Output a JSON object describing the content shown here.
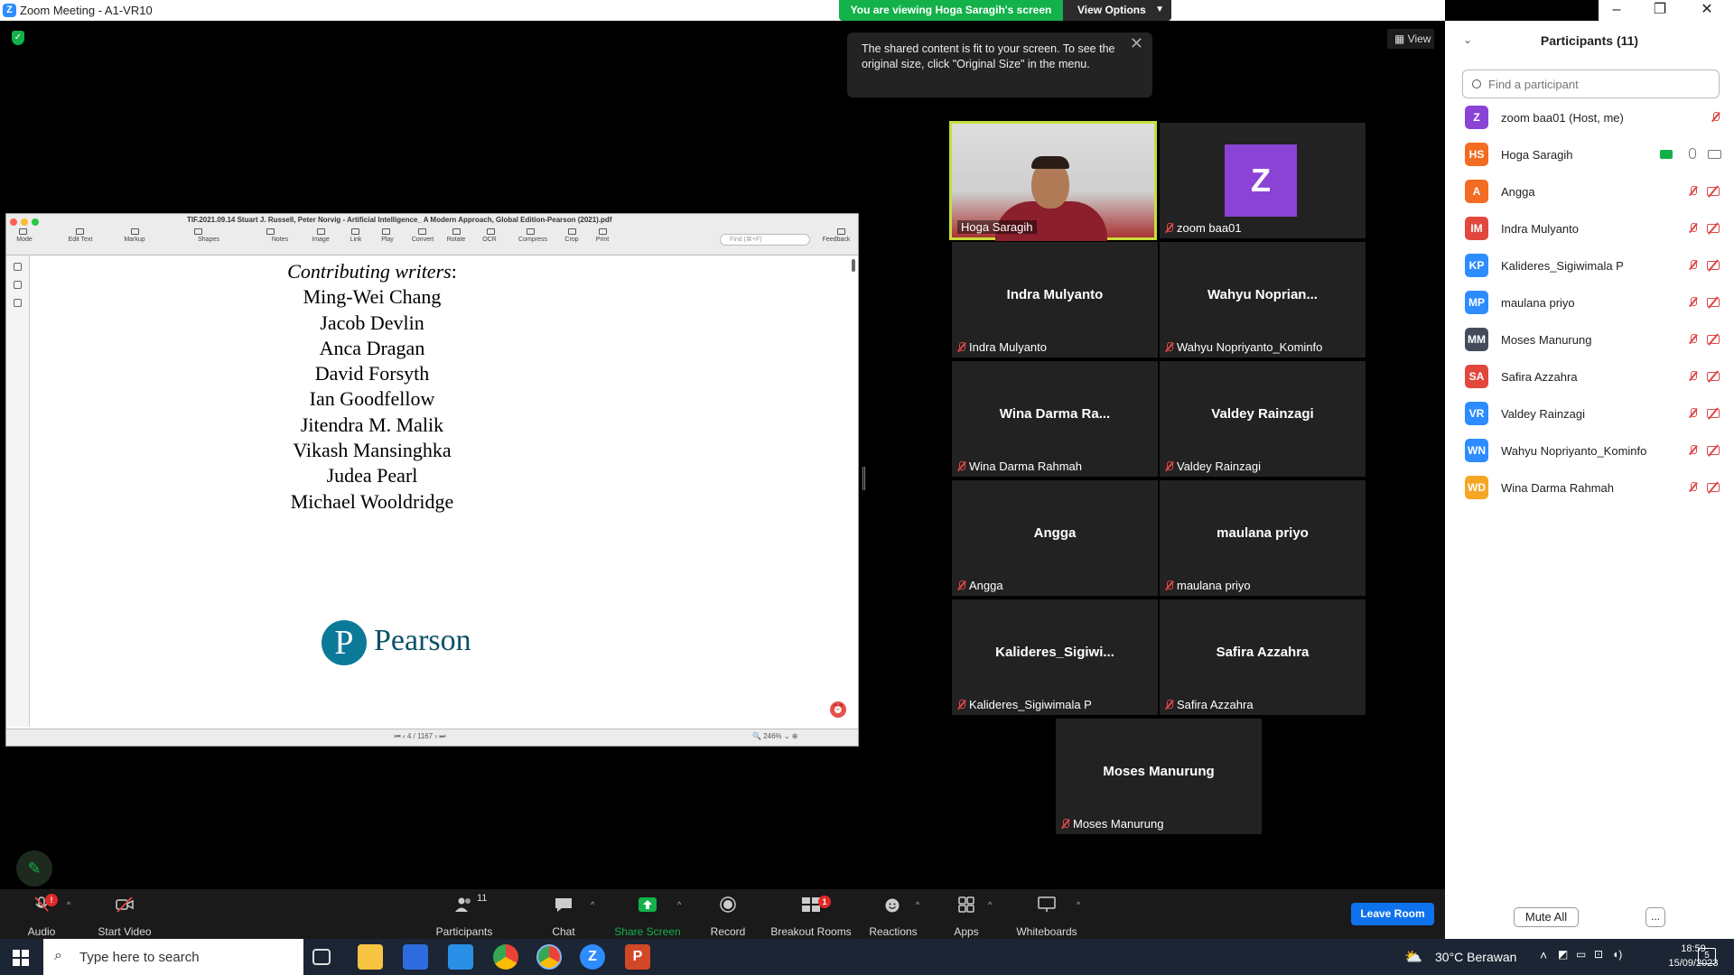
{
  "window": {
    "title": "Zoom Meeting - A1-VR10"
  },
  "banner": {
    "viewing": "You are viewing Hoga Saragih's screen",
    "view_options": "View Options",
    "view": "View"
  },
  "tooltip": {
    "text": "The shared content is fit to your screen. To see the original size, click \"Original Size\" in the menu."
  },
  "pdf": {
    "title": "TIF.2021.09.14 Stuart J. Russell, Peter Norvig - Artificial Intelligence_ A Modern Approach, Global Edition-Pearson (2021).pdf",
    "toolbar": [
      "Mode",
      "Edit Text",
      "Markup",
      "Shapes",
      "Notes",
      "Image",
      "Link",
      "Play",
      "Convert",
      "Rotate",
      "OCR",
      "Compress",
      "Crop",
      "Print",
      "Feedback"
    ],
    "find_placeholder": "Find (⌘+F)",
    "heading": "Contributing writers",
    "writers": [
      "Ming-Wei Chang",
      "Jacob Devlin",
      "Anca Dragan",
      "David Forsyth",
      "Ian Goodfellow",
      "Jitendra M. Malik",
      "Vikash Mansinghka",
      "Judea Pearl",
      "Michael Wooldridge"
    ],
    "publisher": "Pearson",
    "page_current": "4",
    "page_total": "/ 1167",
    "zoom": "246%"
  },
  "gallery": [
    {
      "display": "",
      "label": "Hoga Saragih",
      "video": true,
      "muted": false
    },
    {
      "display": "Z",
      "label": "zoom baa01",
      "video": false,
      "muted": true,
      "avatar": true
    },
    {
      "display": "Indra Mulyanto",
      "label": "Indra Mulyanto",
      "muted": true
    },
    {
      "display": "Wahyu  Noprian...",
      "label": "Wahyu Nopriyanto_Kominfo",
      "muted": true
    },
    {
      "display": "Wina  Darma Ra...",
      "label": "Wina Darma Rahmah",
      "muted": true
    },
    {
      "display": "Valdey Rainzagi",
      "label": "Valdey Rainzagi",
      "muted": true
    },
    {
      "display": "Angga",
      "label": "Angga",
      "muted": true
    },
    {
      "display": "maulana priyo",
      "label": "maulana priyo",
      "muted": true
    },
    {
      "display": "Kalideres_Sigiwi...",
      "label": "Kalideres_Sigiwimala P",
      "muted": true
    },
    {
      "display": "Safira Azzahra",
      "label": "Safira Azzahra",
      "muted": true
    },
    {
      "display": "Moses Manurung",
      "label": "Moses Manurung",
      "muted": true
    }
  ],
  "participants_panel": {
    "title": "Participants (11)",
    "search_placeholder": "Find a participant",
    "mute_all": "Mute All",
    "more": "...",
    "list": [
      {
        "initials": "Z",
        "name": "zoom baa01 (Host, me)",
        "color": "#8b43d6"
      },
      {
        "initials": "HS",
        "name": "Hoga Saragih",
        "color": "#f36c21"
      },
      {
        "initials": "A",
        "name": "Angga",
        "color": "#f36c21"
      },
      {
        "initials": "IM",
        "name": "Indra Mulyanto",
        "color": "#e2473d"
      },
      {
        "initials": "KP",
        "name": "Kalideres_Sigiwimala P",
        "color": "#2d8cff"
      },
      {
        "initials": "MP",
        "name": "maulana priyo",
        "color": "#2d8cff"
      },
      {
        "initials": "MM",
        "name": "Moses Manurung",
        "color": "#444c5c"
      },
      {
        "initials": "SA",
        "name": "Safira Azzahra",
        "color": "#e2473d"
      },
      {
        "initials": "VR",
        "name": "Valdey Rainzagi",
        "color": "#2d8cff"
      },
      {
        "initials": "WN",
        "name": "Wahyu Nopriyanto_Kominfo",
        "color": "#2d8cff"
      },
      {
        "initials": "WD",
        "name": "Wina Darma Rahmah",
        "color": "#f5a623"
      }
    ]
  },
  "controls": {
    "audio": "Audio",
    "start_video": "Start Video",
    "participants": "Participants",
    "participants_count": "11",
    "chat": "Chat",
    "share_screen": "Share Screen",
    "record": "Record",
    "breakout_rooms": "Breakout Rooms",
    "reactions": "Reactions",
    "apps": "Apps",
    "whiteboards": "Whiteboards",
    "leave_room": "Leave Room",
    "audio_badge": "!",
    "breakout_badge": "1"
  },
  "taskbar": {
    "search_placeholder": "Type here to search",
    "weather": "30°C  Berawan",
    "time": "18:59",
    "date": "15/09/2023",
    "notif_count": "5"
  }
}
